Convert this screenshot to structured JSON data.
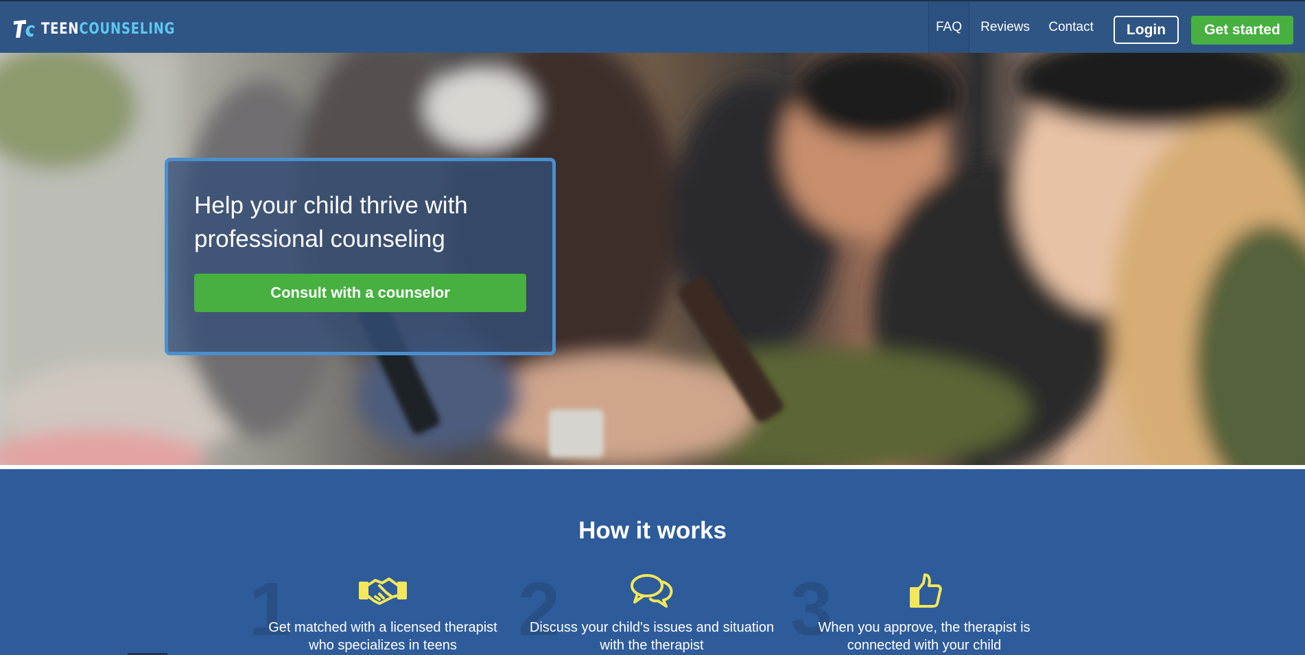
{
  "header": {
    "logo": {
      "teen": "TEEN",
      "counseling": "COUNSELING",
      "icon": "tc-logo-icon"
    },
    "nav": {
      "faq": "FAQ",
      "reviews": "Reviews",
      "contact": "Contact"
    },
    "login_label": "Login",
    "get_started_label": "Get started",
    "colors": {
      "header_bg": "#2f5585",
      "accent_green": "#47b040",
      "logo_blue": "#5ec8f0"
    }
  },
  "hero": {
    "title": "Help your child thrive with professional counseling",
    "cta_label": "Consult with a counselor",
    "image": "teens-using-smartphones-photo"
  },
  "how_it_works": {
    "title": "How it works",
    "steps": [
      {
        "number": "1",
        "icon": "handshake-icon",
        "text": "Get matched with a licensed therapist who specializes in teens"
      },
      {
        "number": "2",
        "icon": "chat-bubbles-icon",
        "text": "Discuss your child's issues and situation with the therapist"
      },
      {
        "number": "3",
        "icon": "thumbs-up-icon",
        "text": "When you approve, the therapist is connected with your child"
      }
    ],
    "colors": {
      "section_bg": "#2e5c9b",
      "icon_yellow": "#f4e85a"
    }
  }
}
